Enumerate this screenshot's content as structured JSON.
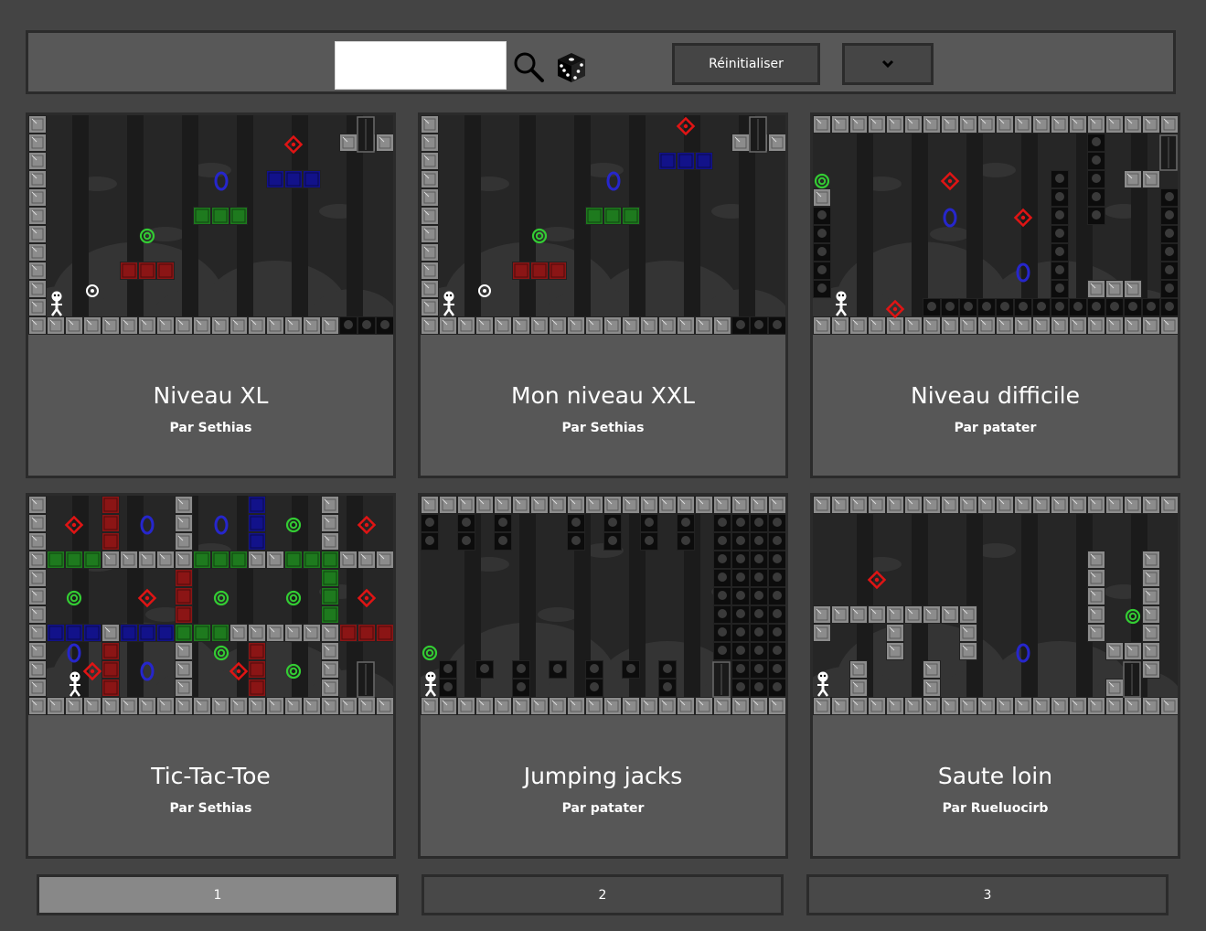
{
  "search": {
    "value": "",
    "placeholder": ""
  },
  "toolbar": {
    "reset_label": "Réinitialiser",
    "search_icon": "search-icon",
    "random_icon": "dice-icon",
    "sort_icon": "chevron-down-icon"
  },
  "levels": [
    {
      "title": "Niveau XL",
      "author": "Par Sethias",
      "preview": "xl"
    },
    {
      "title": "Mon niveau XXL",
      "author": "Par Sethias",
      "preview": "xxl"
    },
    {
      "title": "Niveau difficile",
      "author": "Par patater",
      "preview": "difficile"
    },
    {
      "title": "Tic-Tac-Toe",
      "author": "Par Sethias",
      "preview": "tictactoe"
    },
    {
      "title": "Jumping jacks",
      "author": "Par patater",
      "preview": "jacks"
    },
    {
      "title": "Saute loin",
      "author": "Par Rueluocirb",
      "preview": "saute"
    }
  ],
  "pagination": {
    "pages": [
      "1",
      "2",
      "3"
    ],
    "current_page": "1"
  },
  "colors": {
    "background": "#444444",
    "panel": "#585858",
    "border": "#2b2b2b",
    "button": "#454545",
    "page_active": "#888888",
    "block_red": "#8b1515",
    "block_green": "#1e7a1e",
    "block_blue": "#12128a",
    "marker_red": "#e01414",
    "marker_green": "#33cc33",
    "marker_blue": "#2626cc"
  }
}
